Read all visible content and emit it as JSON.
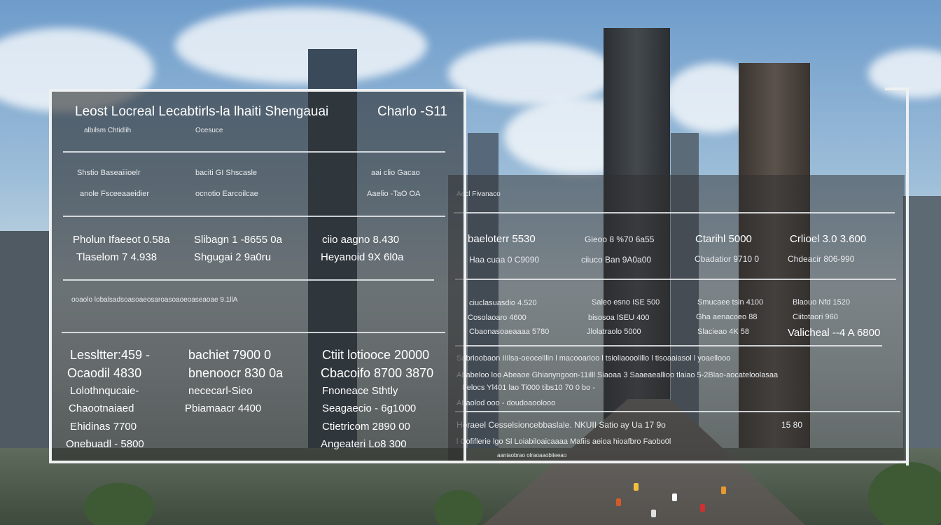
{
  "left_panel": {
    "title": "Leost Locreal Lecabtirls-la lhaiti Shengauai",
    "title_right": "Charlo -S11",
    "subtitle": "albilsm Chtidlih",
    "subtitle_2": "Ocesuce",
    "block1": {
      "col1": [
        "Shstio Baseaiiioelr",
        "anole Fsceeaaeidier"
      ],
      "col2": [
        "baciti GI Shscasle",
        "ocnotio Earcoilcae"
      ],
      "col3": [
        "aai clio Gacao",
        "Aaelio -TaO OA"
      ]
    },
    "block2": {
      "col1": [
        "Pholun Ifaeeot 0.58a",
        "Tlaselom 7 4.938"
      ],
      "col2": [
        "Slibagn 1 -8655  0a",
        "Shgugai 2 9a0ru"
      ],
      "col3": [
        "ciio aagno 8.430",
        "Heyanoid 9X 6l0a"
      ]
    },
    "note": "ooaolo lobalsadsoasoaeosaroasoaoeoaseaoae 9.1llA",
    "block3": {
      "col1": [
        "Lessltter:459 -",
        "Ocaodil 4830",
        "Lolothnqucaie-",
        "Chaootnaiaed",
        "Ehidinas 7700",
        "Onebuadl - 5800"
      ],
      "col2": [
        "bachiet 7900 0",
        "bnenoocr 830 0a",
        "nececarl-Sieo",
        "Pbiamaacr 4400"
      ],
      "col3": [
        "Ctiit lotiooce 20000",
        "Cbacoifo 8700 3870",
        "Fnoneace Sthtly",
        "Seagaecio - 6g1000",
        "Ctietricom 2890 00",
        "Angeateri Lo8 300"
      ]
    }
  },
  "right_panel": {
    "label": "Aecl Fivanaco",
    "row1": {
      "col1": [
        "baeloterr 5530",
        "Haa cuaa 0 C9090"
      ],
      "col2": [
        "Gieoo 8 %70 6a55",
        "ciiuco Ban 9A0a00"
      ],
      "col3": [
        "Ctarihl 5000",
        "Cbadatior 9710 0"
      ],
      "col4": [
        "Crlioel 3.0 3.600",
        "Chdeacir 806-990"
      ]
    },
    "row2": {
      "col1": [
        "ciuclasuasdio 4.520",
        "Cosolaoaro 4600",
        "Cbaonasoaeaaaa 5780"
      ],
      "col2": [
        "Saleo esno ISE 500",
        "bisosoa lSEU 400",
        "Jlolatraolo 5000"
      ],
      "col3": [
        "Smucaee tsin 4100",
        "Gha aenacoeo 88",
        "Slacieao 4K 58"
      ],
      "col4": [
        "Blaouo Nfd 1520",
        "Ciitotaori 960",
        "Valicheal --4 A 6800"
      ]
    },
    "lines": [
      "Sabrioobaon IIIlsa-oeocelllin l macooarioo l tsioliaooolillo l tisoaaiasol l yoaellooo",
      "Ababeloo loo Abeaoe Ghianyngoon-11illl Siaoaa 3 Saaeaeallioo tlaiao 5-2Blao-aocateloolasaa",
      "Felocs Yl401 lao Ti000 tibs10 70 0 bo -",
      "Abaolod ooo - doudoaoolooo"
    ],
    "footer1": "Heraeel Cesselsioncebbaslale. NKUII Satio ay Ua 17  9o",
    "footer1_right": "15 80",
    "footer2": "l Cofiflerie lgo Sl Loiabiloaicaaaa Mafiis aeioa hioafbro Faobo0l",
    "footer3": "aaniaobrao olraoaaobiieeao"
  }
}
